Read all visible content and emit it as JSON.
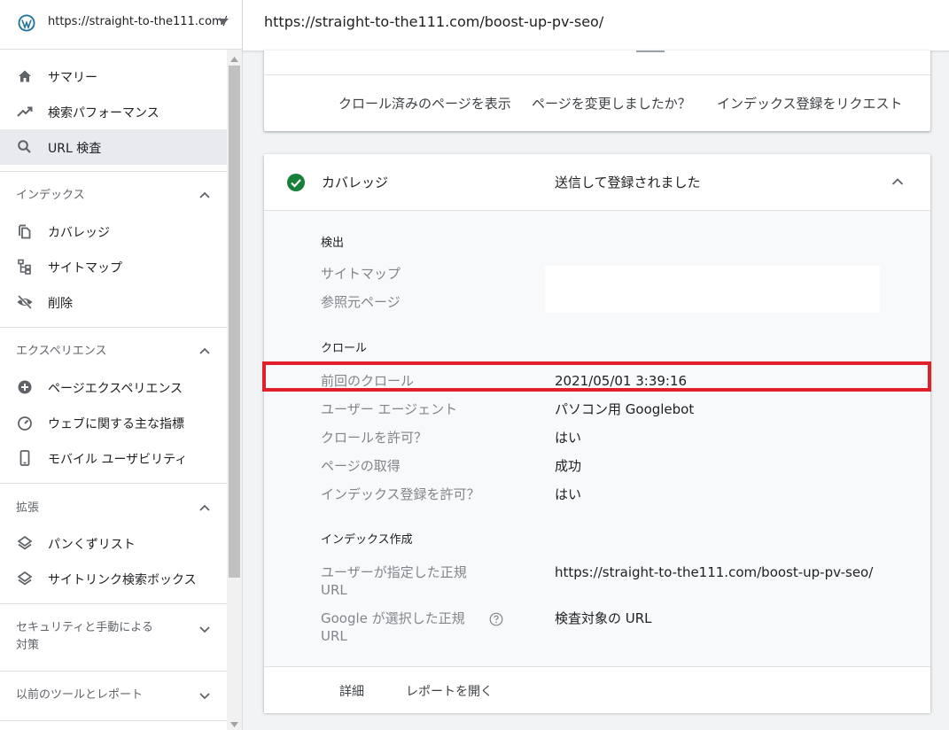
{
  "property": {
    "label": "https://straight-to-the111.com/"
  },
  "topbar": {
    "url": "https://straight-to-the111.com/boost-up-pv-seo/"
  },
  "sidebar": {
    "items": [
      {
        "label": "サマリー",
        "icon": "home-icon"
      },
      {
        "label": "検索パフォーマンス",
        "icon": "trending-up-icon"
      },
      {
        "label": "URL 検査",
        "icon": "search-icon",
        "active": true
      }
    ],
    "sections": [
      {
        "title": "インデックス",
        "expanded": true,
        "items": [
          {
            "label": "カバレッジ",
            "icon": "file-copy-icon"
          },
          {
            "label": "サイトマップ",
            "icon": "sitemap-icon"
          },
          {
            "label": "削除",
            "icon": "eye-off-icon"
          }
        ]
      },
      {
        "title": "エクスペリエンス",
        "expanded": true,
        "items": [
          {
            "label": "ページエクスペリエンス",
            "icon": "plus-circle-icon"
          },
          {
            "label": "ウェブに関する主な指標",
            "icon": "speed-icon"
          },
          {
            "label": "モバイル ユーザビリティ",
            "icon": "smartphone-icon"
          }
        ]
      },
      {
        "title": "拡張",
        "expanded": true,
        "items": [
          {
            "label": "パンくずリスト",
            "icon": "layers-icon"
          },
          {
            "label": "サイトリンク検索ボックス",
            "icon": "layers-icon"
          }
        ]
      },
      {
        "title_line1": "セキュリティと手動による",
        "title_line2": "対策",
        "expanded": false
      },
      {
        "title": "以前のツールとレポート",
        "expanded": false
      }
    ]
  },
  "top_card": {
    "actions": [
      "クロール済みのページを表示",
      "ページを変更しましたか？",
      "インデックス登録をリクエスト"
    ]
  },
  "coverage": {
    "title": "カバレッジ",
    "status": "送信して登録されました",
    "groups": {
      "discovery": {
        "title": "検出",
        "rows": [
          {
            "label": "サイトマップ",
            "value": ""
          },
          {
            "label": "参照元ページ",
            "value": ""
          }
        ]
      },
      "crawl": {
        "title": "クロール",
        "rows": [
          {
            "label": "前回のクロール",
            "value": "2021/05/01 3:39:16"
          },
          {
            "label": "ユーザー エージェント",
            "value": "パソコン用 Googlebot"
          },
          {
            "label": "クロールを許可？",
            "value": "はい"
          },
          {
            "label": "ページの取得",
            "value": "成功"
          },
          {
            "label": "インデックス登録を許可？",
            "value": "はい"
          }
        ]
      },
      "indexing": {
        "title": "インデックス作成",
        "rows": [
          {
            "label_line1": "ユーザーが指定した正規",
            "label_line2": "URL",
            "value": "https://straight-to-the111.com/boost-up-pv-seo/"
          },
          {
            "label_line1": "Google が選択した正規",
            "label_line2": "URL",
            "value": "検査対象の URL"
          }
        ]
      }
    },
    "footer": {
      "details": "詳細",
      "open_report": "レポートを開く"
    }
  },
  "colors": {
    "success_green": "#188038",
    "highlight_red": "#e0212b",
    "label_gray": "#80868b"
  }
}
